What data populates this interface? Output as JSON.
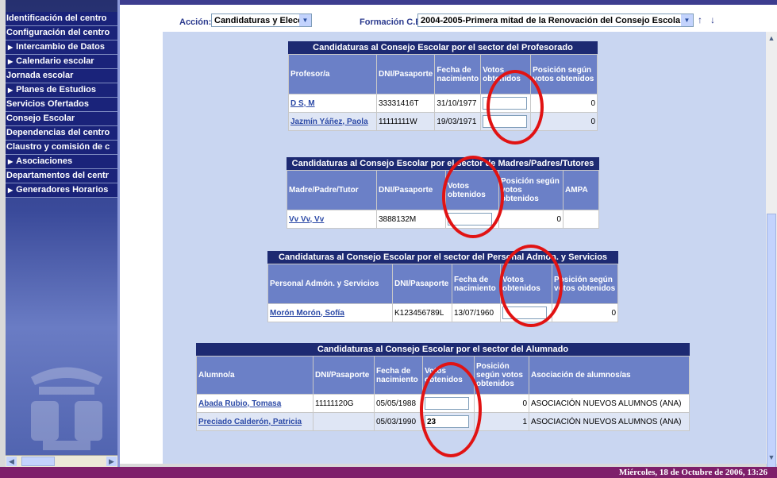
{
  "nav": {
    "items": [
      {
        "label": "Identificación del centro",
        "sub": false
      },
      {
        "label": "Configuración del centro",
        "sub": false
      },
      {
        "label": "Intercambio de Datos",
        "sub": true
      },
      {
        "label": "Calendario escolar",
        "sub": true
      },
      {
        "label": "Jornada escolar",
        "sub": false
      },
      {
        "label": "Planes de Estudios",
        "sub": true
      },
      {
        "label": "Servicios Ofertados",
        "sub": false
      },
      {
        "label": "Consejo Escolar",
        "sub": false
      },
      {
        "label": "Dependencias del centro",
        "sub": false
      },
      {
        "label": "Claustro y comisión de c",
        "sub": false
      },
      {
        "label": "Asociaciones",
        "sub": true
      },
      {
        "label": "Departamentos del centr",
        "sub": false
      },
      {
        "label": "Generadores Horarios",
        "sub": true
      }
    ]
  },
  "toolbar": {
    "accion_label": "Acción:",
    "accion_value": "Candidaturas y Eleccior",
    "formacion_label": "Formación C.E.:",
    "formacion_value": "2004-2005-Primera mitad de la Renovación del Consejo Escola",
    "up_glyph": "↑",
    "down_glyph": "↓"
  },
  "tables": {
    "profesorado": {
      "caption": "Candidaturas al Consejo Escolar por el sector del Profesorado",
      "headers": [
        "Profesor/a",
        "DNI/Pasaporte",
        "Fecha de nacimiento",
        "Votos obtenidos",
        "Posición según votos obtenidos"
      ],
      "rows": [
        {
          "name": "D S, M",
          "dni": "33331416T",
          "fecha": "31/10/1977",
          "votos": "",
          "pos": "0"
        },
        {
          "name": "Jazmín Yáñez, Paola",
          "dni": "11111111W",
          "fecha": "19/03/1971",
          "votos": "",
          "pos": "0"
        }
      ]
    },
    "padres": {
      "caption": "Candidaturas al Consejo Escolar por el sector de Madres/Padres/Tutores",
      "headers": [
        "Madre/Padre/Tutor",
        "DNI/Pasaporte",
        "Votos obtenidos",
        "Posición según votos obtenidos",
        "AMPA"
      ],
      "rows": [
        {
          "name": "Vv Vv, Vv",
          "dni": "3888132M",
          "votos": "",
          "pos": "0",
          "ampa": ""
        }
      ]
    },
    "pas": {
      "caption": "Candidaturas al Consejo Escolar por el sector del Personal Admón. y Servicios",
      "headers": [
        "Personal Admón. y Servicios",
        "DNI/Pasaporte",
        "Fecha de nacimiento",
        "Votos obtenidos",
        "Posición según votos obtenidos"
      ],
      "rows": [
        {
          "name": "Morón Morón, Sofía",
          "dni": "K123456789L",
          "fecha": "13/07/1960",
          "votos": "",
          "pos": "0"
        }
      ]
    },
    "alumnado": {
      "caption": "Candidaturas al Consejo Escolar por el sector del Alumnado",
      "headers": [
        "Alumno/a",
        "DNI/Pasaporte",
        "Fecha de nacimiento",
        "Votos obtenidos",
        "Posición según votos obtenidos",
        "Asociación de alumnos/as"
      ],
      "rows": [
        {
          "name": "Abada Rubio, Tomasa",
          "dni": "11111120G",
          "fecha": "05/05/1988",
          "votos": "",
          "pos": "0",
          "asoc": "ASOCIACIÓN NUEVOS ALUMNOS (ANA)"
        },
        {
          "name": "Preciado Calderón, Patricia",
          "dni": "",
          "fecha": "05/03/1990",
          "votos": "23",
          "pos": "1",
          "asoc": "ASOCIACIÓN NUEVOS ALUMNOS (ANA)"
        }
      ]
    }
  },
  "status": {
    "datetime": "Miércoles, 18 de Octubre de 2006, 13:26"
  },
  "colors": {
    "nav": "#1a237a",
    "header": "#6b80c7",
    "caption": "#1d2a72",
    "status": "#7e1f6a",
    "highlight": "#e11313"
  }
}
